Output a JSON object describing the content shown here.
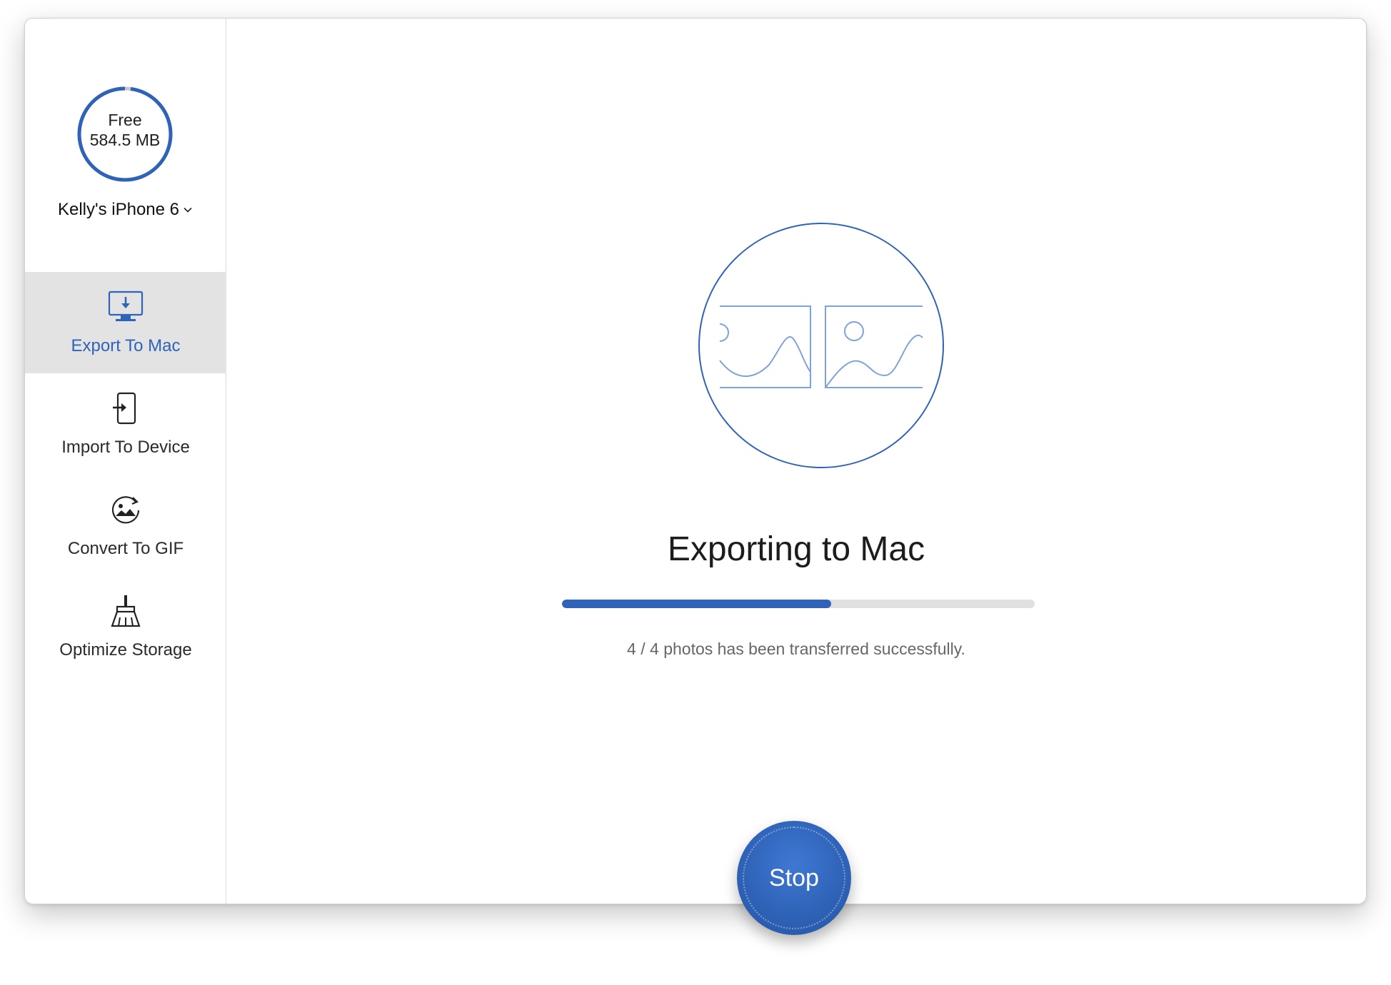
{
  "device": {
    "storage_label": "Free",
    "storage_value": "584.5 MB",
    "storage_free_fraction": 0.98,
    "name": "Kelly's iPhone 6"
  },
  "sidebar": {
    "items": [
      {
        "label": "Export To Mac",
        "icon": "monitor-download-icon",
        "active": true
      },
      {
        "label": "Import To Device",
        "icon": "phone-import-icon",
        "active": false
      },
      {
        "label": "Convert To GIF",
        "icon": "gif-convert-icon",
        "active": false
      },
      {
        "label": "Optimize Storage",
        "icon": "broom-icon",
        "active": false
      }
    ]
  },
  "main": {
    "title": "Exporting to Mac",
    "progress_fraction": 0.57,
    "status": "4 / 4 photos has been transferred successfully.",
    "stop_label": "Stop"
  },
  "colors": {
    "accent": "#2f63b7",
    "active_bg": "#e3e3e3",
    "progress_track": "#e0e0e0",
    "close": "#fc5a53",
    "minimize": "#fdbc2e"
  }
}
